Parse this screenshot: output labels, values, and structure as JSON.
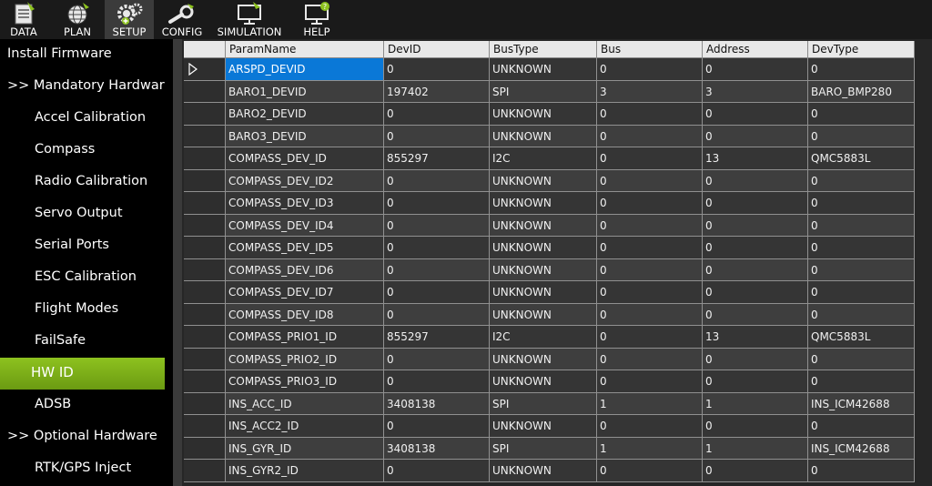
{
  "menu": {
    "items": [
      {
        "label": "DATA",
        "icon": "data-icon"
      },
      {
        "label": "PLAN",
        "icon": "globe-icon"
      },
      {
        "label": "SETUP",
        "icon": "gears-icon"
      },
      {
        "label": "CONFIG",
        "icon": "wrench-icon"
      },
      {
        "label": "SIMULATION",
        "icon": "monitor-icon"
      },
      {
        "label": "HELP",
        "icon": "help-monitor-icon"
      }
    ],
    "active": "SETUP"
  },
  "sidebar": {
    "items": [
      {
        "label": "Install Firmware"
      },
      {
        "label": ">> Mandatory Hardware"
      },
      {
        "label": "Accel Calibration"
      },
      {
        "label": "Compass"
      },
      {
        "label": "Radio Calibration"
      },
      {
        "label": "Servo Output"
      },
      {
        "label": "Serial Ports"
      },
      {
        "label": "ESC Calibration"
      },
      {
        "label": "Flight Modes"
      },
      {
        "label": "FailSafe"
      },
      {
        "label": "HW ID"
      },
      {
        "label": "ADSB"
      },
      {
        "label": ">> Optional Hardware"
      },
      {
        "label": "RTK/GPS Inject"
      }
    ],
    "active": "HW ID"
  },
  "table": {
    "headers": [
      "ParamName",
      "DevID",
      "BusType",
      "Bus",
      "Address",
      "DevType"
    ],
    "rows": [
      [
        "ARSPD_DEVID",
        "0",
        "UNKNOWN",
        "0",
        "0",
        "0"
      ],
      [
        "BARO1_DEVID",
        "197402",
        "SPI",
        "3",
        "3",
        "BARO_BMP280"
      ],
      [
        "BARO2_DEVID",
        "0",
        "UNKNOWN",
        "0",
        "0",
        "0"
      ],
      [
        "BARO3_DEVID",
        "0",
        "UNKNOWN",
        "0",
        "0",
        "0"
      ],
      [
        "COMPASS_DEV_ID",
        "855297",
        "I2C",
        "0",
        "13",
        "QMC5883L"
      ],
      [
        "COMPASS_DEV_ID2",
        "0",
        "UNKNOWN",
        "0",
        "0",
        "0"
      ],
      [
        "COMPASS_DEV_ID3",
        "0",
        "UNKNOWN",
        "0",
        "0",
        "0"
      ],
      [
        "COMPASS_DEV_ID4",
        "0",
        "UNKNOWN",
        "0",
        "0",
        "0"
      ],
      [
        "COMPASS_DEV_ID5",
        "0",
        "UNKNOWN",
        "0",
        "0",
        "0"
      ],
      [
        "COMPASS_DEV_ID6",
        "0",
        "UNKNOWN",
        "0",
        "0",
        "0"
      ],
      [
        "COMPASS_DEV_ID7",
        "0",
        "UNKNOWN",
        "0",
        "0",
        "0"
      ],
      [
        "COMPASS_DEV_ID8",
        "0",
        "UNKNOWN",
        "0",
        "0",
        "0"
      ],
      [
        "COMPASS_PRIO1_ID",
        "855297",
        "I2C",
        "0",
        "13",
        "QMC5883L"
      ],
      [
        "COMPASS_PRIO2_ID",
        "0",
        "UNKNOWN",
        "0",
        "0",
        "0"
      ],
      [
        "COMPASS_PRIO3_ID",
        "0",
        "UNKNOWN",
        "0",
        "0",
        "0"
      ],
      [
        "INS_ACC_ID",
        "3408138",
        "SPI",
        "1",
        "1",
        "INS_ICM42688"
      ],
      [
        "INS_ACC2_ID",
        "0",
        "UNKNOWN",
        "0",
        "0",
        "0"
      ],
      [
        "INS_GYR_ID",
        "3408138",
        "SPI",
        "1",
        "1",
        "INS_ICM42688"
      ],
      [
        "INS_GYR2_ID",
        "0",
        "UNKNOWN",
        "0",
        "0",
        "0"
      ]
    ],
    "selected_row": 0
  },
  "colors": {
    "accent": "#7cb31a",
    "selection": "#0a78d7",
    "menu_bg": "#1a1a1a"
  }
}
